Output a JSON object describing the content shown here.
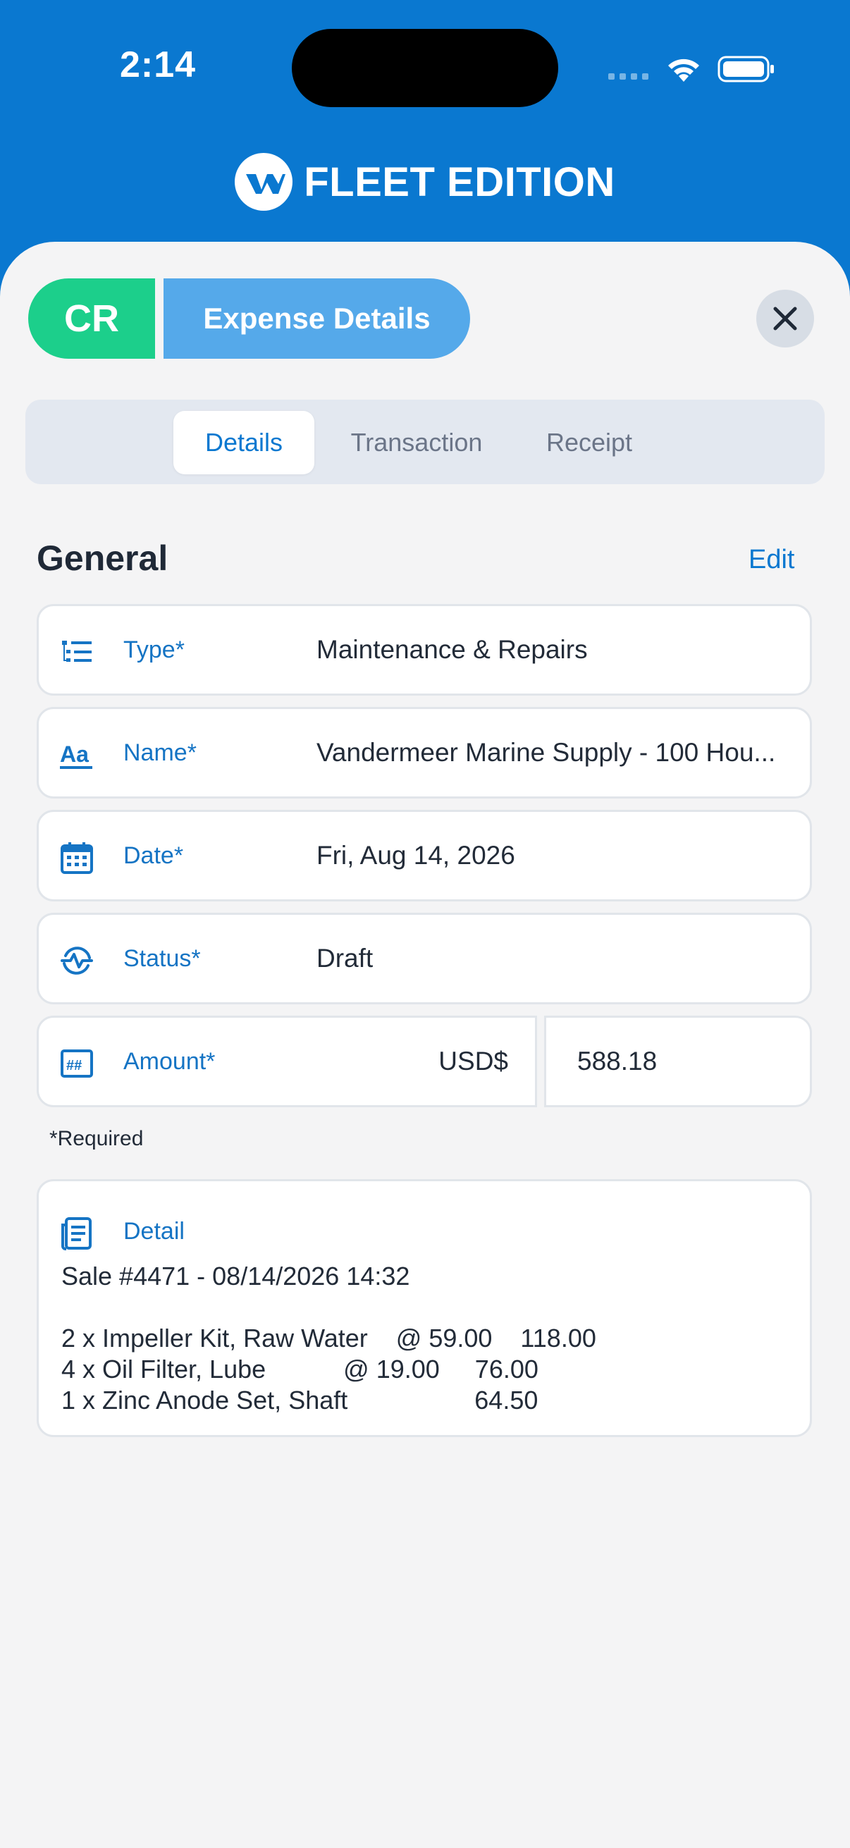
{
  "status_bar": {
    "time": "2:14"
  },
  "brand": {
    "name": "FLEET EDITION"
  },
  "header": {
    "badge": "CR",
    "title": "Expense Details"
  },
  "tabs": [
    {
      "label": "Details",
      "active": true
    },
    {
      "label": "Transaction",
      "active": false
    },
    {
      "label": "Receipt",
      "active": false
    }
  ],
  "section": {
    "title": "General",
    "edit_label": "Edit"
  },
  "fields": {
    "type": {
      "label": "Type*",
      "value": "Maintenance & Repairs",
      "icon": "list-icon"
    },
    "name": {
      "label": "Name*",
      "value": "Vandermeer Marine Supply - 100 Hou...",
      "icon": "text-format-icon"
    },
    "date": {
      "label": "Date*",
      "value": "Fri, Aug 14, 2026",
      "icon": "calendar-icon"
    },
    "status": {
      "label": "Status*",
      "value": "Draft",
      "icon": "activity-icon"
    },
    "amount": {
      "label": "Amount*",
      "currency": "USD$",
      "value": "588.18",
      "icon": "number-icon"
    }
  },
  "required_note": "*Required",
  "detail": {
    "label": "Detail",
    "text": "Sale #4471 - 08/14/2026 14:32\n\n2 x Impeller Kit, Raw Water    @ 59.00    118.00\n4 x Oil Filter, Lube           @ 19.00     76.00\n1 x Zinc Anode Set, Shaft                  64.50"
  },
  "colors": {
    "brand_blue": "#0a78d0",
    "badge_green": "#1ccf8b",
    "title_pill": "#55a9ea",
    "label_blue": "#1574c4"
  }
}
